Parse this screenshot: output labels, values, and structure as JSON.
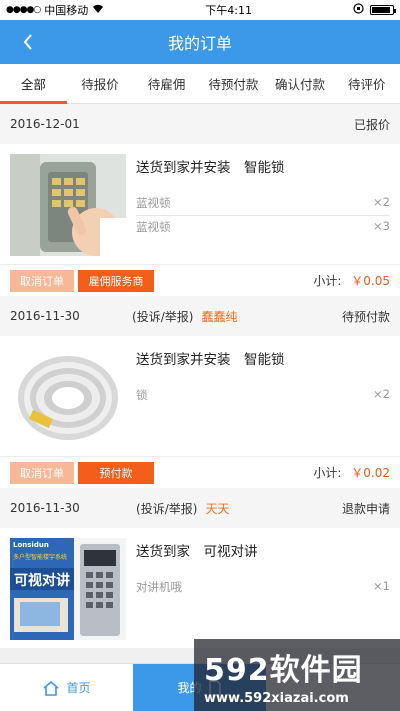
{
  "status_bar": {
    "carrier": "中国移动",
    "time": "下午4:11"
  },
  "nav": {
    "title": "我的订单"
  },
  "tabs": [
    {
      "label": "全部"
    },
    {
      "label": "待报价"
    },
    {
      "label": "待雇佣"
    },
    {
      "label": "待预付款"
    },
    {
      "label": "确认付款"
    },
    {
      "label": "待评价"
    }
  ],
  "orders": [
    {
      "date": "2016-12-01",
      "complain": "",
      "seller": "",
      "status": "已报价",
      "title": "送货到家并安装　智能锁",
      "items": [
        {
          "name": "蓝视顿",
          "qty": "×2"
        },
        {
          "name": "蓝视顿",
          "qty": "×3"
        }
      ],
      "btn_cancel": "取消订单",
      "btn_main": "雇佣服务商",
      "subtotal_label": "小计:",
      "subtotal": "￥0.05"
    },
    {
      "date": "2016-11-30",
      "complain": "(投诉/举报)",
      "seller": "蠢蠢纯",
      "status": "待预付款",
      "title": "送货到家并安装　智能锁",
      "items": [
        {
          "name": "锁",
          "qty": "×2"
        }
      ],
      "btn_cancel": "取消订单",
      "btn_main": "预付款",
      "subtotal_label": "小计:",
      "subtotal": "￥0.02"
    },
    {
      "date": "2016-11-30",
      "complain": "(投诉/举报)",
      "seller": "天天",
      "status": "退款申请",
      "title": "送货到家　可视对讲",
      "items": [
        {
          "name": "对讲机哦",
          "qty": "×1"
        }
      ],
      "product_img_text": {
        "brand": "Lonsidun",
        "headline": "可视对讲",
        "sub": "多户型智能楼宇系统"
      }
    }
  ],
  "bottom_tabs": [
    {
      "label": "首页"
    },
    {
      "label": "我的"
    }
  ],
  "watermark": {
    "logo": "592软件园",
    "url": "www.592xiazai.com"
  },
  "colors": {
    "primary": "#3c98e8",
    "accent": "#f05a1e",
    "accent_light": "#f8b898"
  }
}
